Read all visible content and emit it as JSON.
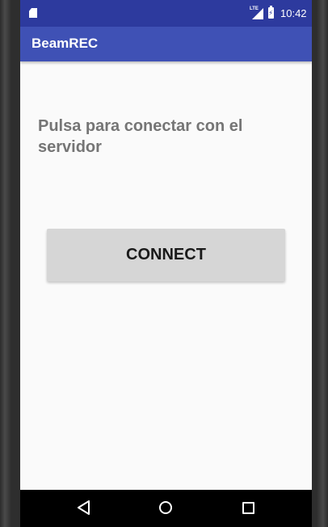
{
  "status_bar": {
    "time": "10:42",
    "network_label": "LTE",
    "icons": [
      "sd-card-icon",
      "lte-icon",
      "signal-icon",
      "battery-charging-icon"
    ]
  },
  "app_bar": {
    "title": "BeamREC"
  },
  "main": {
    "prompt": "Pulsa para conectar con el servidor",
    "connect_label": "CONNECT"
  },
  "nav_bar": {
    "icons": [
      "back-icon",
      "home-icon",
      "recents-icon"
    ]
  },
  "colors": {
    "status_bar": "#2d3a9e",
    "app_bar": "#3f51b5",
    "background": "#fafafa",
    "prompt_text": "#757575",
    "button": "#d6d6d6"
  }
}
